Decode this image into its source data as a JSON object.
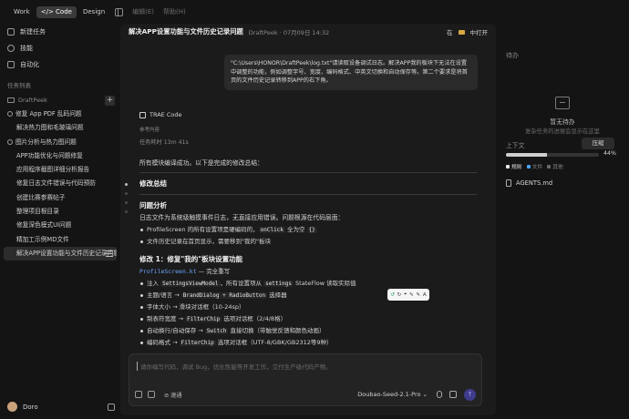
{
  "topbar": {
    "modes": [
      "Work",
      "</> Code",
      "Design"
    ],
    "menus": [
      "编辑(E)",
      "帮助(H)"
    ]
  },
  "sidebar": {
    "nav": [
      "新建任务",
      "技能",
      "自动化"
    ],
    "section_label": "任务列表",
    "project": "DraftPeek",
    "add_symbol": "+",
    "tasks": [
      {
        "label": "修复 App PDF 乱码问题",
        "group": true
      },
      {
        "label": "解决热力图和毛玻璃问题"
      },
      {
        "label": "图片分析与热力图问题",
        "group": true
      },
      {
        "label": "APP功能优化与问题修复"
      },
      {
        "label": "应用程序截图详细分析报告"
      },
      {
        "label": "修复日志文件错误与代码预防"
      },
      {
        "label": "创建比赛参赛帖子"
      },
      {
        "label": "整理项目根目录"
      },
      {
        "label": "修复深色模式UI问题"
      },
      {
        "label": "精加工示例MD文件"
      },
      {
        "label": "解决APP设置功能与文件历史记录问题",
        "selected": true
      }
    ],
    "user": "Doro"
  },
  "main": {
    "title": "解决APP设置功能与文件历史记录问题",
    "meta": "DraftPeek · 07月09日 14:32",
    "open_in": "在",
    "open_label": "中打开",
    "user_message": "\"C:\\Users\\HONOR\\DraftPeek\\log.txt\"请读取设备调试日志。解决APP我的板块下无法在设置中调整的功能，例如调整字号、宽度、编码格式、中英文切换和自动保存等。第二个要求是将首页的文件历史记录转移到APP的右下角。",
    "agent_name": "TRAE Code",
    "ref": "参考内容",
    "work_time": "任务耗时 13m 41s",
    "summary_intro": "所有模块编译成功。以下是完成的修改总结：",
    "h_summary": "修改总结",
    "h_analysis": "问题分析",
    "analysis_text": "日志文件为系统级触摸事件日志，无直接应用错误。问题根源在代码层面：",
    "bullets_a": [
      {
        "pre": "ProfileScreen 的所有设置项是硬编码的，",
        "code": "onClick",
        "post": " 全为空 ",
        "code2": "{}"
      },
      {
        "pre": "文件历史记录在首页显示，需要移到\"我的\"板块"
      }
    ],
    "h_fix1": "修改 1：修复\"我的\"板块设置功能",
    "fix1_file": "ProfileScreen.kt",
    "fix1_dash": " — 完全重写",
    "bullets_b": [
      {
        "pre": "注入 ",
        "code": "SettingsViewModel",
        "post": "，所有设置项从 ",
        "code2": "settings",
        "post2": " StateFlow 读取实际值"
      },
      {
        "pre": "主题/语言 → ",
        "code": "BrandDialog + RadioButton",
        "post": " 选择器"
      },
      {
        "pre": "字体大小 → 滑块对话框（10-24sp）"
      },
      {
        "pre": "制表符宽度 → ",
        "code": "FilterChip",
        "post": " 选项对话框（2/4/8格）"
      },
      {
        "pre": "自动换行/自动保存 → ",
        "code": "Switch",
        "post": " 直接切换（带触觉反馈和颜色动画）"
      },
      {
        "pre": "编码格式 → ",
        "code": "FilterChip",
        "post": " 选项对话框（UTF-8/GBK/GB2312等9种）"
      }
    ],
    "mini_toolbar": [
      "↺",
      "↻",
      "⌖",
      "✎",
      "✎",
      "A"
    ],
    "composer": {
      "placeholder": "请你编写代码，调试 Bug，优化性能等开发工作，交付生产级代码产物。",
      "auto_label": "⊘ 速通",
      "model": "Doubao-Seed-2.1-Pro ⌄",
      "send": "↑"
    }
  },
  "right": {
    "todo_title": "待办",
    "empty_title": "暂无待办",
    "empty_sub": "复杂任务的进展会显示在这里",
    "context_label": "上下文",
    "compress": "压缩",
    "context_progress": 0.44,
    "context_pct": "44%",
    "legend": [
      {
        "label": "规则",
        "color": "#e6e6e6"
      },
      {
        "label": "文件",
        "color": "#4aa3ff"
      },
      {
        "label": "其他",
        "color": "#6a6a6a"
      }
    ],
    "file": "AGENTS.md"
  }
}
